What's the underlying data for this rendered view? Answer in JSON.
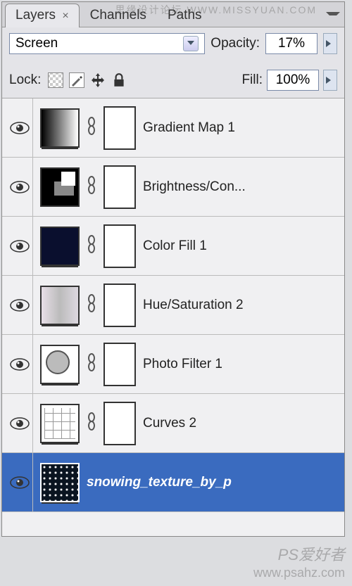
{
  "tabs": {
    "layers": "Layers",
    "channels": "Channels",
    "paths": "Paths"
  },
  "blend_mode": "Screen",
  "opacity_label": "Opacity:",
  "opacity_value": "17%",
  "lock_label": "Lock:",
  "fill_label": "Fill:",
  "fill_value": "100%",
  "layers": [
    {
      "name": "Gradient Map 1",
      "thumb": "grad"
    },
    {
      "name": "Brightness/Con...",
      "thumb": "bc"
    },
    {
      "name": "Color Fill 1",
      "thumb": "colorfill"
    },
    {
      "name": "Hue/Saturation 2",
      "thumb": "huesat"
    },
    {
      "name": "Photo Filter 1",
      "thumb": "photofilter"
    },
    {
      "name": "Curves 2",
      "thumb": "curves"
    },
    {
      "name": "snowing_texture_by_p",
      "thumb": "snow",
      "selected": true
    }
  ],
  "watermarks": {
    "top": "思缘设计论坛 WWW.MISSYUAN.COM",
    "br1": "PS爱好者",
    "br2": "www.psahz.com"
  }
}
